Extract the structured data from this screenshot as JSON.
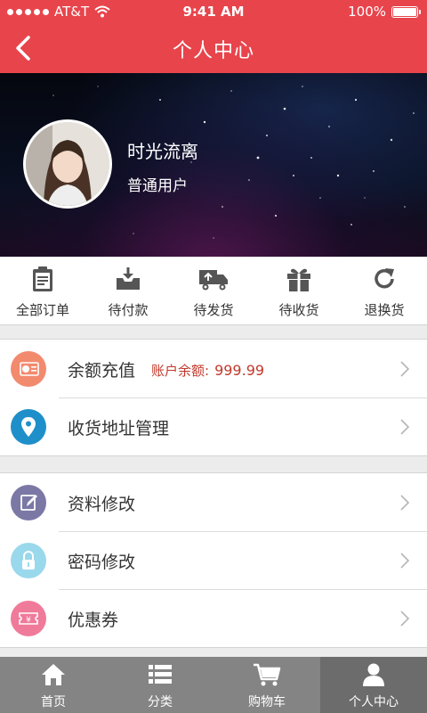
{
  "status_bar": {
    "carrier": "AT&T",
    "time": "9:41 AM",
    "battery": "100%"
  },
  "nav": {
    "title": "个人中心",
    "back_icon": "chevron-left-icon"
  },
  "profile": {
    "name": "时光流离",
    "level": "普通用户"
  },
  "orders": [
    {
      "label": "全部订单",
      "icon": "clipboard-icon"
    },
    {
      "label": "待付款",
      "icon": "inbox-download-icon"
    },
    {
      "label": "待发货",
      "icon": "truck-icon"
    },
    {
      "label": "待收货",
      "icon": "gift-icon"
    },
    {
      "label": "退换货",
      "icon": "refresh-icon"
    }
  ],
  "account_group": [
    {
      "label": "余额充值",
      "icon": "money-icon",
      "icon_color": "#f28a6e",
      "balance_label": "账户余额:",
      "balance_value": "999.99"
    },
    {
      "label": "收货地址管理",
      "icon": "location-pin-icon",
      "icon_color": "#1f8fc9"
    }
  ],
  "settings_group": [
    {
      "label": "资料修改",
      "icon": "edit-icon",
      "icon_color": "#7b78a6"
    },
    {
      "label": "密码修改",
      "icon": "lock-icon",
      "icon_color": "#9ad8ec"
    },
    {
      "label": "优惠券",
      "icon": "coupon-icon",
      "icon_color": "#f07a9a"
    }
  ],
  "tabs": [
    {
      "label": "首页",
      "icon": "home-icon"
    },
    {
      "label": "分类",
      "icon": "list-icon"
    },
    {
      "label": "购物车",
      "icon": "cart-icon"
    },
    {
      "label": "个人中心",
      "icon": "user-icon",
      "active": true
    }
  ],
  "colors": {
    "brand_red": "#e8444c",
    "tab_bg": "#848484",
    "tab_active_bg": "#6c6c6c",
    "balance_text": "#c0392b"
  }
}
